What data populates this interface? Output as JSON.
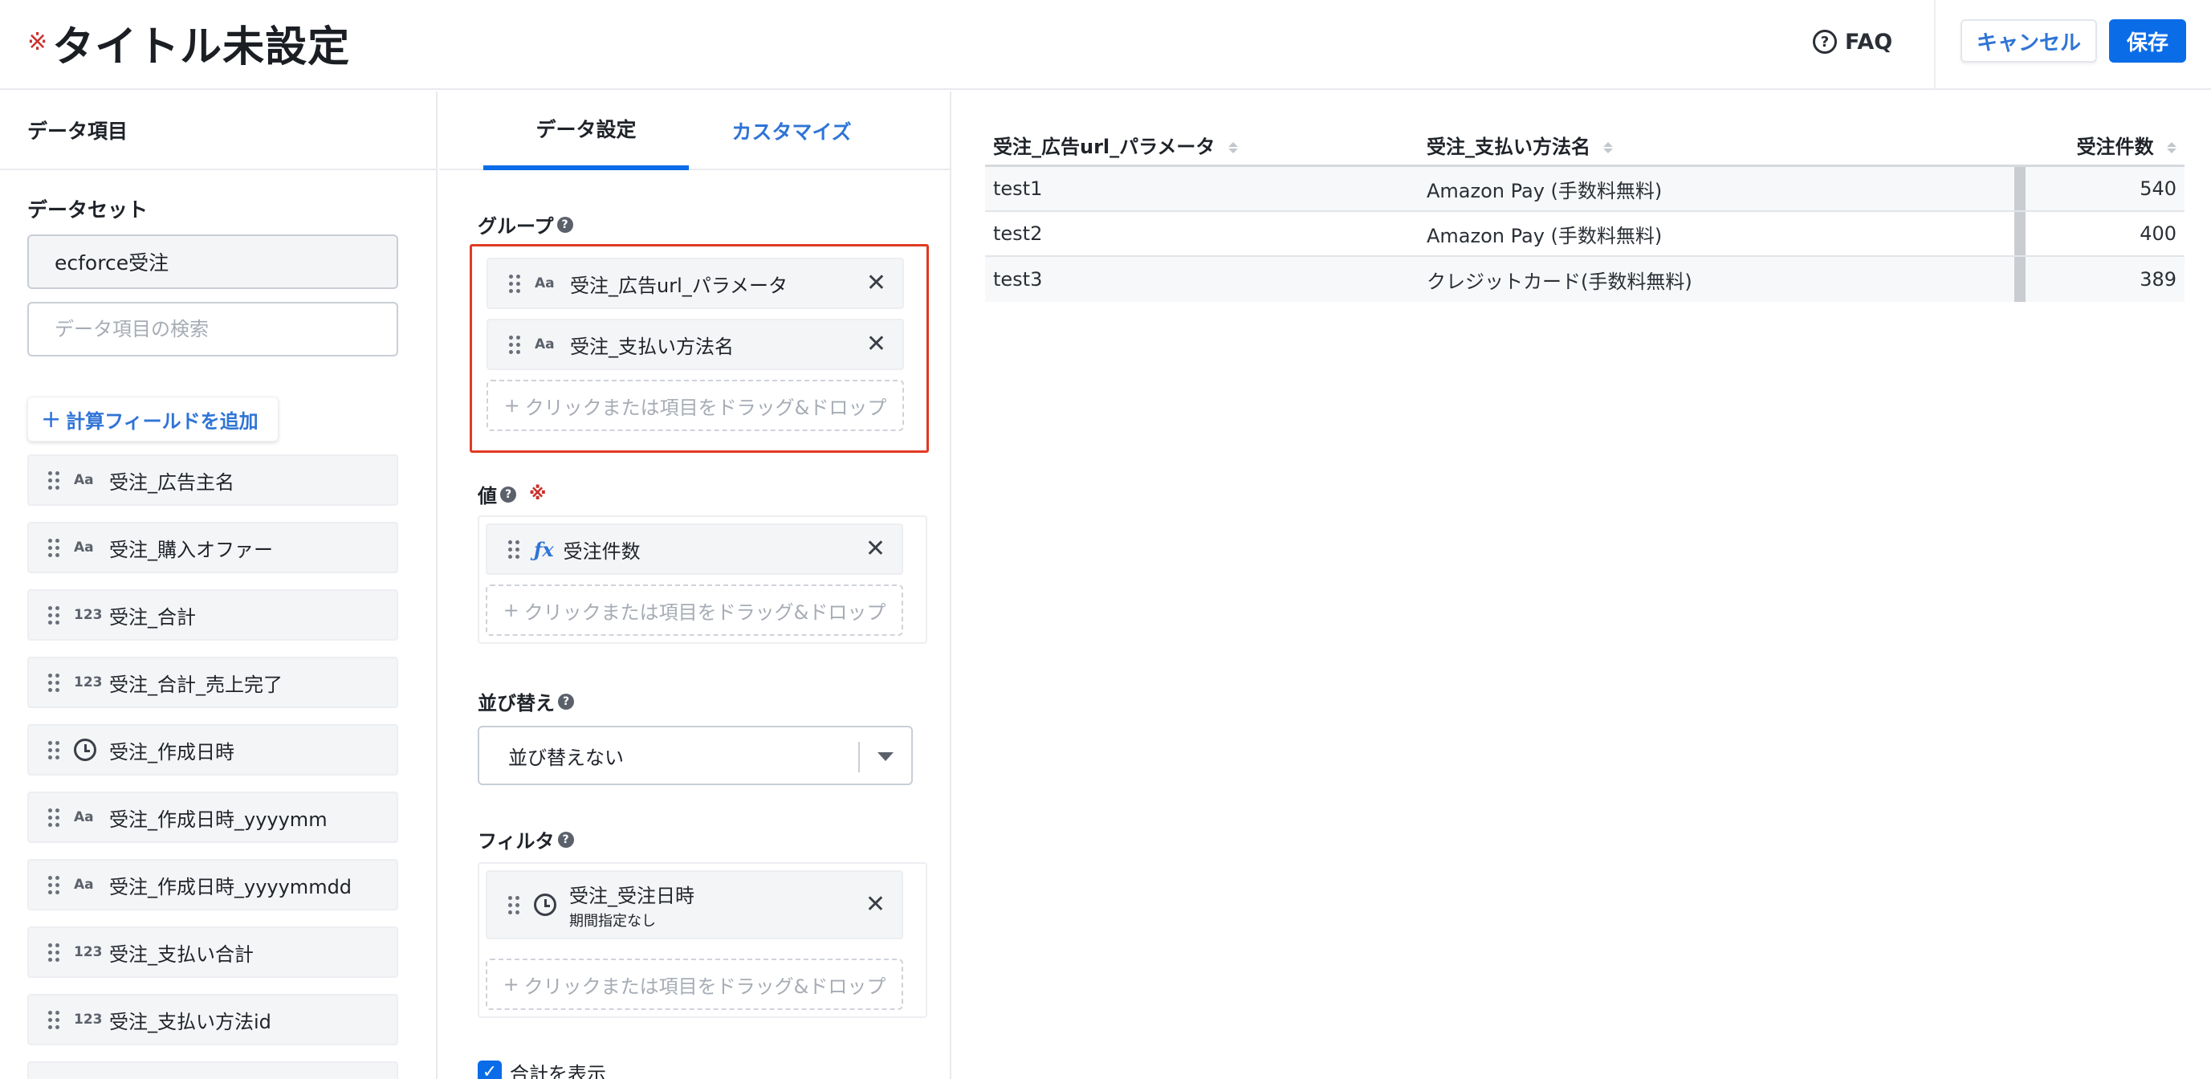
{
  "header": {
    "required_mark": "※",
    "title": "タイトル未設定",
    "faq_label": "FAQ",
    "cancel_label": "キャンセル",
    "save_label": "保存"
  },
  "left_panel": {
    "heading": "データ項目",
    "dataset_label": "データセット",
    "dataset_value": "ecforce受注",
    "search_placeholder": "データ項目の検索",
    "add_calc_label": "計算フィールドを追加",
    "fields": [
      {
        "type": "Aa",
        "label": "受注_広告主名"
      },
      {
        "type": "Aa",
        "label": "受注_購入オファー"
      },
      {
        "type": "123",
        "label": "受注_合計"
      },
      {
        "type": "123",
        "label": "受注_合計_売上完了"
      },
      {
        "type": "clock",
        "label": "受注_作成日時"
      },
      {
        "type": "Aa",
        "label": "受注_作成日時_yyyymm"
      },
      {
        "type": "Aa",
        "label": "受注_作成日時_yyyymmdd"
      },
      {
        "type": "123",
        "label": "受注_支払い合計"
      },
      {
        "type": "123",
        "label": "受注_支払い方法id"
      }
    ]
  },
  "middle_panel": {
    "tabs": {
      "data": "データ設定",
      "customize": "カスタマイズ"
    },
    "group": {
      "label": "グループ",
      "items": [
        {
          "type": "Aa",
          "label": "受注_広告url_パラメータ"
        },
        {
          "type": "Aa",
          "label": "受注_支払い方法名"
        }
      ],
      "dropzone": "クリックまたは項目をドラッグ&ドロップ"
    },
    "value": {
      "label": "値",
      "required_mark": "※",
      "items": [
        {
          "type": "fx",
          "label": "受注件数"
        }
      ],
      "dropzone": "クリックまたは項目をドラッグ&ドロップ"
    },
    "sort": {
      "label": "並び替え",
      "selected": "並び替えない"
    },
    "filter": {
      "label": "フィルタ",
      "items": [
        {
          "type": "clock",
          "label": "受注_受注日時",
          "sub": "期間指定なし"
        }
      ],
      "dropzone": "クリックまたは項目をドラッグ&ドロップ"
    },
    "show_total_label": "合計を表示"
  },
  "table": {
    "columns": [
      "受注_広告url_パラメータ",
      "受注_支払い方法名",
      "受注件数"
    ],
    "rows": [
      [
        "test1",
        "Amazon Pay (手数料無料)",
        "540"
      ],
      [
        "test2",
        "Amazon Pay (手数料無料)",
        "400"
      ],
      [
        "test3",
        "クレジットカード(手数料無料)",
        "389"
      ]
    ]
  },
  "colors": {
    "accent": "#0b6ce8",
    "link": "#2f74d6",
    "required": "#c9302c",
    "highlight_border": "#e03a22"
  }
}
